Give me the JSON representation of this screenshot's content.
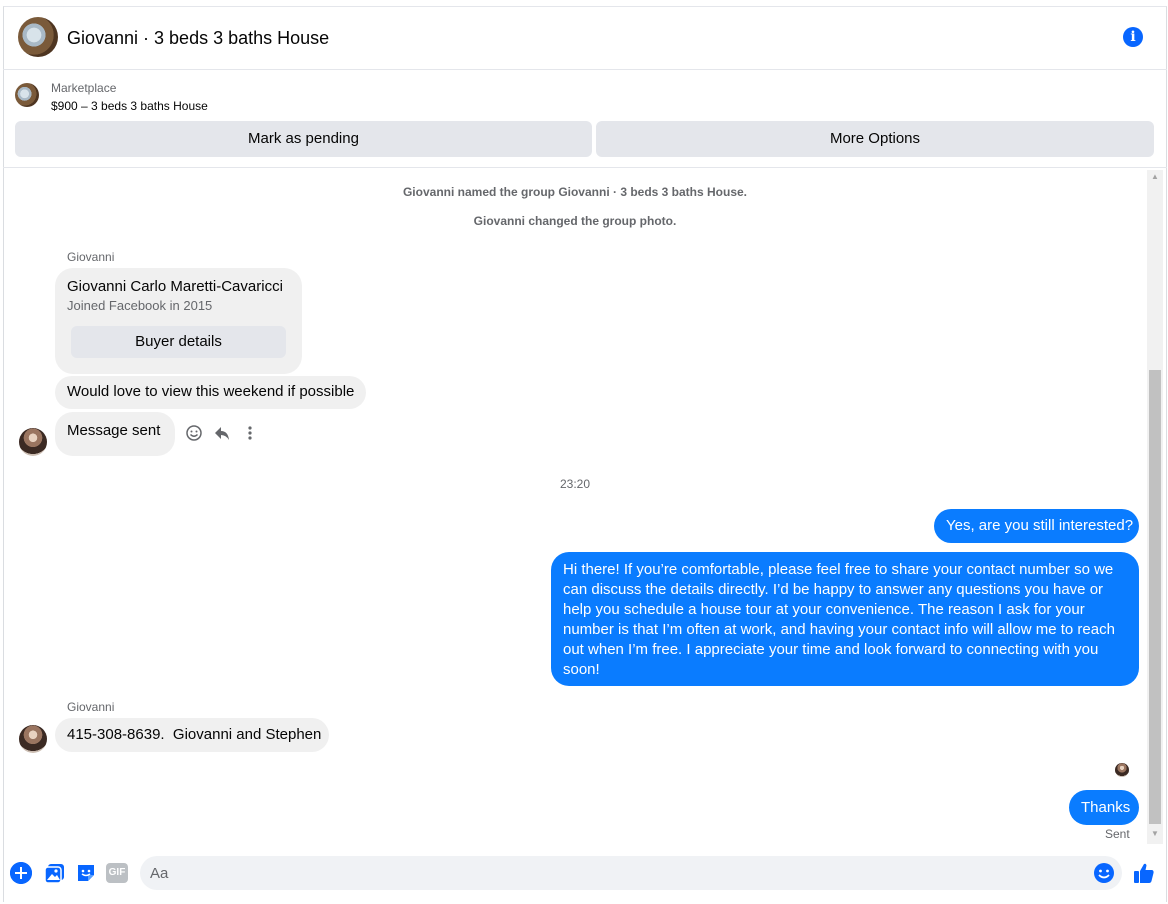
{
  "header": {
    "title": "Giovanni · 3 beds 3 baths House"
  },
  "marketplace": {
    "label": "Marketplace",
    "listing": "$900 – 3 beds 3 baths House",
    "mark_pending_label": "Mark as pending",
    "more_options_label": "More Options"
  },
  "chat": {
    "system_messages": [
      "Giovanni named the group Giovanni · 3 beds 3 baths House.",
      "Giovanni changed the group photo."
    ],
    "buyer_card": {
      "sender": "Giovanni",
      "name": "Giovanni Carlo Maretti-Cavaricci",
      "joined": "Joined Facebook in 2015",
      "details_button": "Buyer details"
    },
    "incoming_1": "Would love to view this weekend if possible",
    "incoming_2": "Message sent",
    "timestamp": "23:20",
    "outgoing_1": "Yes, are you still interested?",
    "outgoing_2": "Hi there! If you’re comfortable, please feel free to share your contact number so we can discuss the details directly. I’d be happy to answer any questions you have or help you schedule a house tour at your convenience. The reason I ask for your number is that I’m often at work, and having your contact info will allow me to reach out when I’m free. I appreciate your time and look forward to connecting with you soon!",
    "sender_2": "Giovanni",
    "incoming_3": "415-308-8639.  Giovanni and Stephen",
    "outgoing_3": "Thanks",
    "status": "Sent"
  },
  "composer": {
    "placeholder": "Aa",
    "gif_label": "GIF"
  },
  "colors": {
    "accent": "#0866ff",
    "outgoing_bubble": "#0a7cff",
    "incoming_bubble": "#f0f0f0"
  }
}
